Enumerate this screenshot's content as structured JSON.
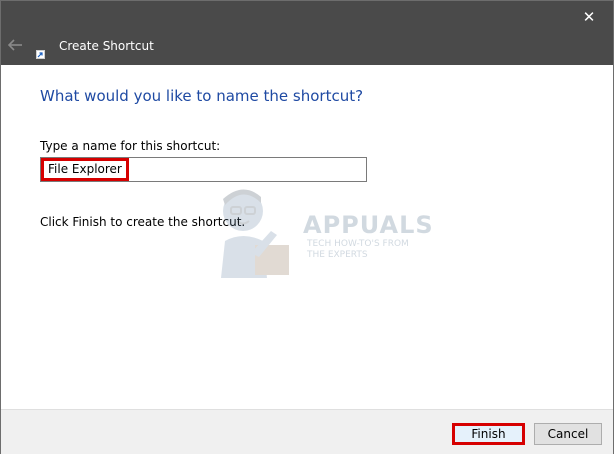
{
  "window": {
    "title": "Create Shortcut",
    "close_glyph": "✕",
    "back_icon": "back-arrow-icon",
    "app_icon": "shortcut-icon"
  },
  "main": {
    "heading": "What would you like to name the shortcut?",
    "name_label": "Type a name for this shortcut:",
    "name_value": "File Explorer",
    "info": "Click Finish to create the shortcut."
  },
  "watermark": {
    "brand": "APPUALS",
    "tagline": "TECH HOW-TO'S FROM THE EXPERTS"
  },
  "footer": {
    "finish_label": "Finish",
    "cancel_label": "Cancel"
  },
  "colors": {
    "titlebar": "#4a4a4a",
    "heading": "#1f4aa3",
    "highlight": "#d60000"
  }
}
